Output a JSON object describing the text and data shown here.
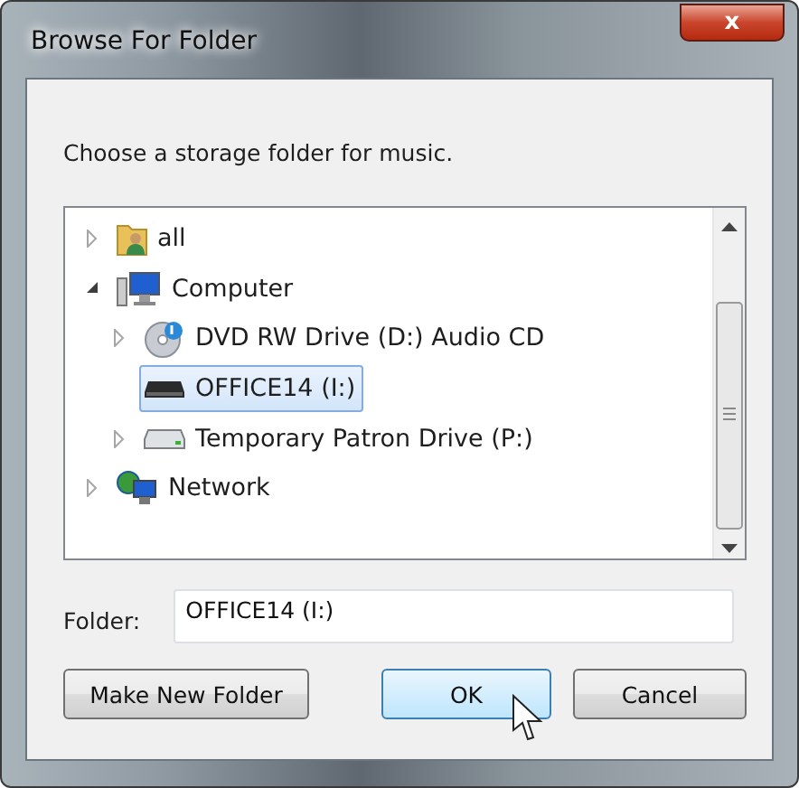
{
  "window": {
    "title": "Browse For Folder",
    "close": "x"
  },
  "prompt": "Choose a storage folder for music.",
  "tree": [
    {
      "label": "all",
      "kind": "user-folder",
      "expandable": true,
      "expanded": false,
      "selected": false
    },
    {
      "label": "Computer",
      "kind": "computer",
      "expandable": true,
      "expanded": true,
      "selected": false,
      "children": [
        {
          "label": "DVD RW Drive (D:) Audio CD",
          "kind": "disc",
          "expandable": true,
          "expanded": false,
          "selected": false
        },
        {
          "label": "OFFICE14 (I:)",
          "kind": "removable",
          "expandable": false,
          "expanded": false,
          "selected": true
        },
        {
          "label": "Temporary Patron Drive (P:)",
          "kind": "drive",
          "expandable": true,
          "expanded": false,
          "selected": false
        }
      ]
    },
    {
      "label": "Network",
      "kind": "network",
      "expandable": true,
      "expanded": false,
      "selected": false
    }
  ],
  "folder": {
    "label": "Folder:",
    "value": "OFFICE14 (I:)"
  },
  "buttons": [
    {
      "label": "Make New Folder",
      "default": false
    },
    {
      "label": "OK",
      "default": true
    },
    {
      "label": "Cancel",
      "default": false
    }
  ]
}
